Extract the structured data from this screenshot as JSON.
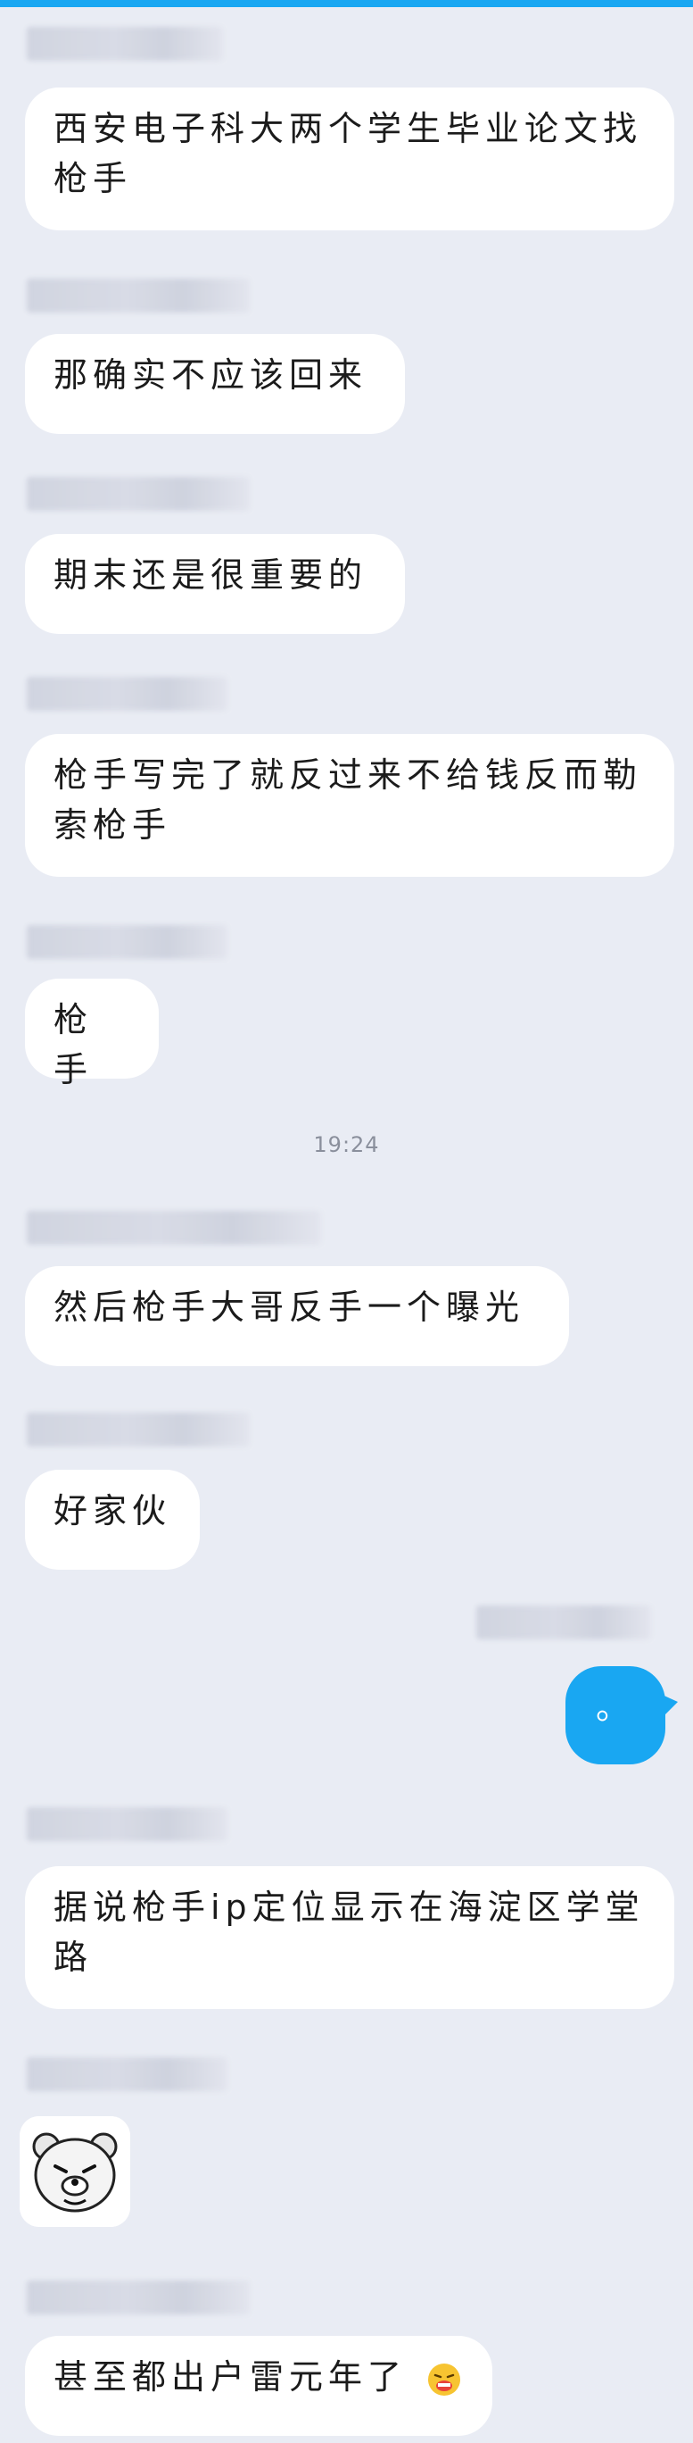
{
  "messages": [
    {
      "text": "西安电子科大两个学生毕业论文找枪手"
    },
    {
      "text": "那确实不应该回来"
    },
    {
      "text": "期末还是很重要的"
    },
    {
      "text": "枪手写完了就反过来不给钱反而勒索枪手"
    },
    {
      "text": "枪手"
    },
    {
      "text": "然后枪手大哥反手一个曝光"
    },
    {
      "text": "好家伙"
    },
    {
      "text": "。"
    },
    {
      "text": "据说枪手ip定位显示在海淀区学堂路"
    },
    {
      "sticker": "bear-face-sticker"
    },
    {
      "text": "甚至都出户雷元年了"
    }
  ],
  "timestamp": "19:24",
  "colors": {
    "background": "#e9ecf4",
    "incoming_bubble": "#ffffff",
    "outgoing_bubble": "#19a7f2",
    "accent": "#19a7f2"
  },
  "icons": {
    "inline_emoji": "grimace-emoji-icon",
    "sticker": "bear-face-sticker"
  }
}
